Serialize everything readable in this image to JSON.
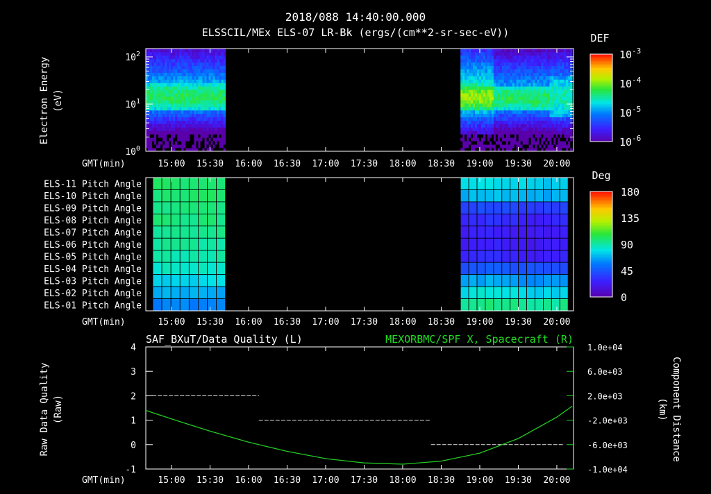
{
  "header": {
    "title": "2018/088 14:40:00.000",
    "subtitle": "ELSSCIL/MEx ELS-07 LR-Bk  (ergs/(cm**2-sr-sec-eV))"
  },
  "colors": {
    "background": "#000000",
    "foreground": "#ffffff",
    "right_axis_green": "#22dd22",
    "line_green": "#22cc22",
    "quality_dash": "#e8e8e8"
  },
  "time_axis": {
    "label": "GMT(min)",
    "start_minutes": 880,
    "end_minutes": 1213,
    "tick_minutes": [
      900,
      930,
      960,
      990,
      1020,
      1050,
      1080,
      1110,
      1140,
      1170,
      1200
    ],
    "tick_labels": [
      "15:00",
      "15:30",
      "16:00",
      "16:30",
      "17:00",
      "17:30",
      "18:00",
      "18:30",
      "19:00",
      "19:30",
      "20:00"
    ]
  },
  "chart_data": [
    {
      "type": "heatmap",
      "title": "ELSSCIL/MEx ELS-07 LR-Bk  (ergs/(cm**2-sr-sec-eV))",
      "ylabel": "Electron Energy\n(eV)",
      "ylabel_lines": [
        "Electron Energy",
        "(eV)"
      ],
      "xlabel": "GMT(min)",
      "yscale": "log",
      "ylim": [
        1,
        150
      ],
      "y_tick_labels": [
        "10^0",
        "10^1",
        "10^2"
      ],
      "colorbar": {
        "title": "DEF",
        "scale": "log",
        "range": [
          1e-06,
          0.001
        ],
        "tick_labels": [
          "10^-3",
          "10^-4",
          "10^-5",
          "10^-6"
        ]
      },
      "data_intervals": [
        {
          "start": "14:40",
          "end": "15:42"
        },
        {
          "start": "18:45",
          "end": "20:12"
        }
      ],
      "bands": [
        {
          "start": "14:40",
          "end": "15:42",
          "energy_range_eV": [
            7,
            30
          ],
          "level": "1e-4.3"
        },
        {
          "start": "18:45",
          "end": "19:10",
          "energy_range_eV": [
            8,
            25
          ],
          "level": "1e-3.9"
        },
        {
          "start": "19:10",
          "end": "19:55",
          "energy_range_eV": [
            7,
            25
          ],
          "level": "1e-4.3"
        },
        {
          "start": "19:55",
          "end": "20:12",
          "energy_range_eV": [
            5,
            40
          ],
          "level": "1e-4.5"
        }
      ]
    },
    {
      "type": "heatmap",
      "xlabel": "GMT(min)",
      "row_labels": [
        "ELS-11 Pitch Angle",
        "ELS-10 Pitch Angle",
        "ELS-09 Pitch Angle",
        "ELS-08 Pitch Angle",
        "ELS-07 Pitch Angle",
        "ELS-06 Pitch Angle",
        "ELS-05 Pitch Angle",
        "ELS-04 Pitch Angle",
        "ELS-03 Pitch Angle",
        "ELS-02 Pitch Angle",
        "ELS-01 Pitch Angle"
      ],
      "colorbar": {
        "title": "Deg",
        "range": [
          0,
          180
        ],
        "tick_labels": [
          "180",
          "135",
          "90",
          "45",
          "0"
        ]
      },
      "segments": [
        {
          "start": "14:40",
          "end": "15:42",
          "columns": 8,
          "values_deg": [
            100,
            100,
            98,
            97,
            95,
            93,
            90,
            86,
            78,
            68,
            60
          ]
        },
        {
          "start": "18:45",
          "end": "20:12",
          "columns": 13,
          "values_deg": [
            78,
            70,
            40,
            30,
            25,
            25,
            28,
            45,
            65,
            80,
            95
          ]
        }
      ]
    },
    {
      "type": "line",
      "title": "SAF_BXuT/Data Quality (L)",
      "title_right": "MEXORBMC/SPF X, Spacecraft (R)",
      "xlabel": "GMT(min)",
      "ylabel": "Raw Data Quality\n(Raw)",
      "ylabel_lines": [
        "Raw Data Quality",
        "(Raw)"
      ],
      "ylabel_right": "Component Distance\n(km)",
      "ylabel_right_lines": [
        "Component Distance",
        "(km)"
      ],
      "ylim": [
        -1,
        4
      ],
      "y_tick_labels": [
        "4",
        "3",
        "2",
        "1",
        "0",
        "-1"
      ],
      "ylim_right": [
        -10000,
        10000
      ],
      "y_right_tick_labels": [
        "1.0e+04",
        "6.0e+03",
        "2.0e+03",
        "-2.0e+03",
        "-6.0e+03",
        "-1.0e+04"
      ],
      "series": [
        {
          "name": "SAF_BXuT/Data Quality (L)",
          "axis": "left",
          "style": "dashed",
          "segments": [
            {
              "start": "14:45",
              "end": "16:08",
              "value": 2
            },
            {
              "start": "16:08",
              "end": "18:22",
              "value": 1
            },
            {
              "start": "18:22",
              "end": "20:05",
              "value": 0
            }
          ]
        },
        {
          "name": "MEXORBMC/SPF X, Spacecraft (R)",
          "axis": "right",
          "style": "solid",
          "x": [
            "14:40",
            "15:00",
            "15:30",
            "16:00",
            "16:30",
            "17:00",
            "17:30",
            "18:00",
            "18:30",
            "19:00",
            "19:30",
            "20:00",
            "20:12"
          ],
          "y": [
            -400,
            -1800,
            -3800,
            -5600,
            -7100,
            -8300,
            -9000,
            -9200,
            -8700,
            -7400,
            -5000,
            -1500,
            300
          ]
        }
      ]
    }
  ]
}
